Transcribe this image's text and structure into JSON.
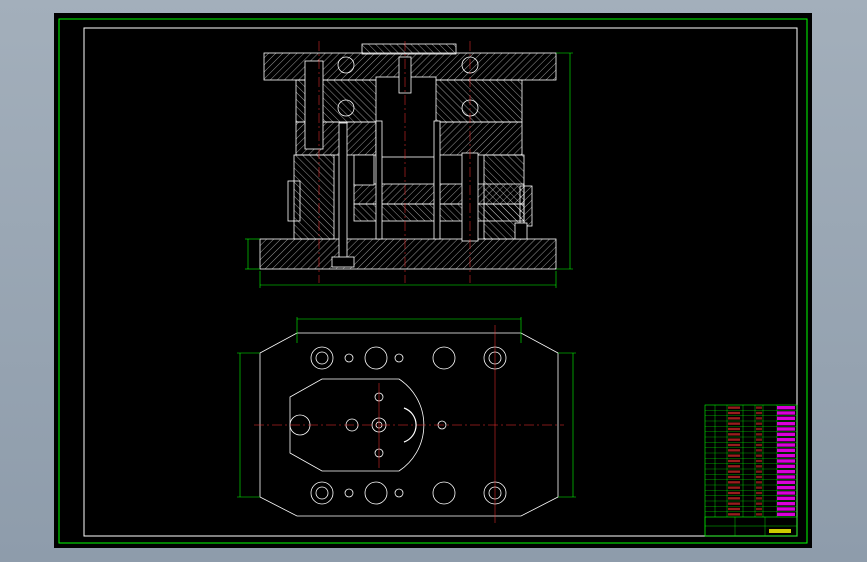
{
  "drawing": {
    "colors": {
      "background": "#000000",
      "frame": "#00ff00",
      "geometry": "#ffffff",
      "dimension": "#00ff00",
      "title_block_grid": "#00ff00",
      "title_block_pink": "#ff00ff",
      "title_block_red": "#ff3030",
      "title_block_yellow": "#ffff00",
      "center_line": "#ff3030"
    },
    "views": {
      "section_view": {
        "name": "front-section-view"
      },
      "plan_view": {
        "name": "bottom-plan-view"
      }
    },
    "title_block": {
      "rows": 21,
      "footer_cells": [
        "",
        "",
        "",
        ""
      ]
    }
  }
}
